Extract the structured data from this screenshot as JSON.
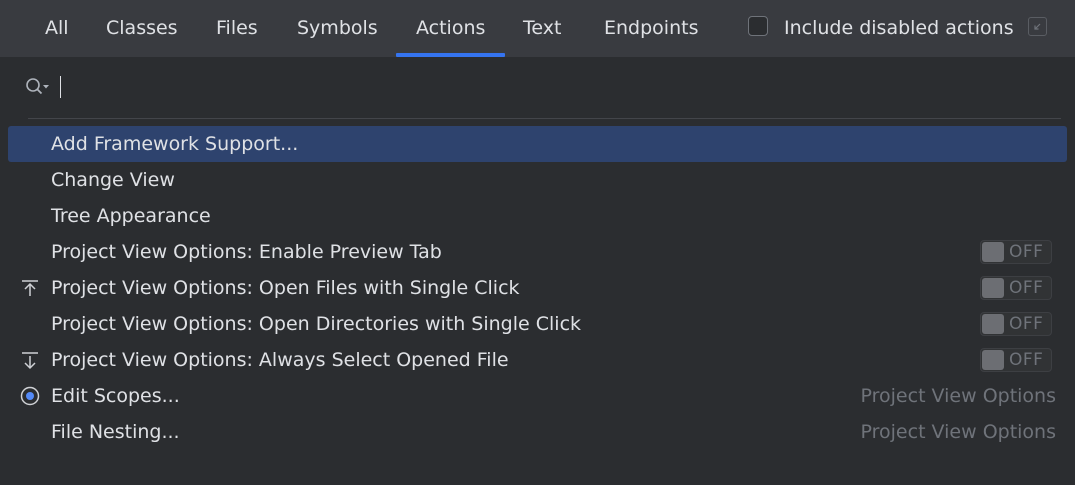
{
  "tabs": [
    {
      "label": "All",
      "active": false
    },
    {
      "label": "Classes",
      "active": false
    },
    {
      "label": "Files",
      "active": false
    },
    {
      "label": "Symbols",
      "active": false
    },
    {
      "label": "Actions",
      "active": true
    },
    {
      "label": "Text",
      "active": false
    },
    {
      "label": "Endpoints",
      "active": false
    }
  ],
  "include_disabled": {
    "label": "Include disabled actions",
    "checked": false
  },
  "search": {
    "value": "",
    "placeholder": ""
  },
  "results": [
    {
      "label": "Add Framework Support...",
      "selected": true
    },
    {
      "label": "Change View"
    },
    {
      "label": "Tree Appearance"
    },
    {
      "label": "Project View Options: Enable Preview Tab",
      "toggle": "OFF"
    },
    {
      "label": "Project View Options: Open Files with Single Click",
      "icon": "scroll-from-source-icon",
      "toggle": "OFF"
    },
    {
      "label": "Project View Options: Open Directories with Single Click",
      "toggle": "OFF"
    },
    {
      "label": "Project View Options: Always Select Opened File",
      "icon": "scroll-to-source-icon",
      "toggle": "OFF"
    },
    {
      "label": "Edit Scopes...",
      "icon": "scope-icon",
      "location": "Project View Options"
    },
    {
      "label": "File Nesting...",
      "location": "Project View Options"
    }
  ],
  "colors": {
    "background": "#2b2d30",
    "tabbar": "#393b40",
    "accent": "#3574f0",
    "selection": "#2e436e"
  }
}
